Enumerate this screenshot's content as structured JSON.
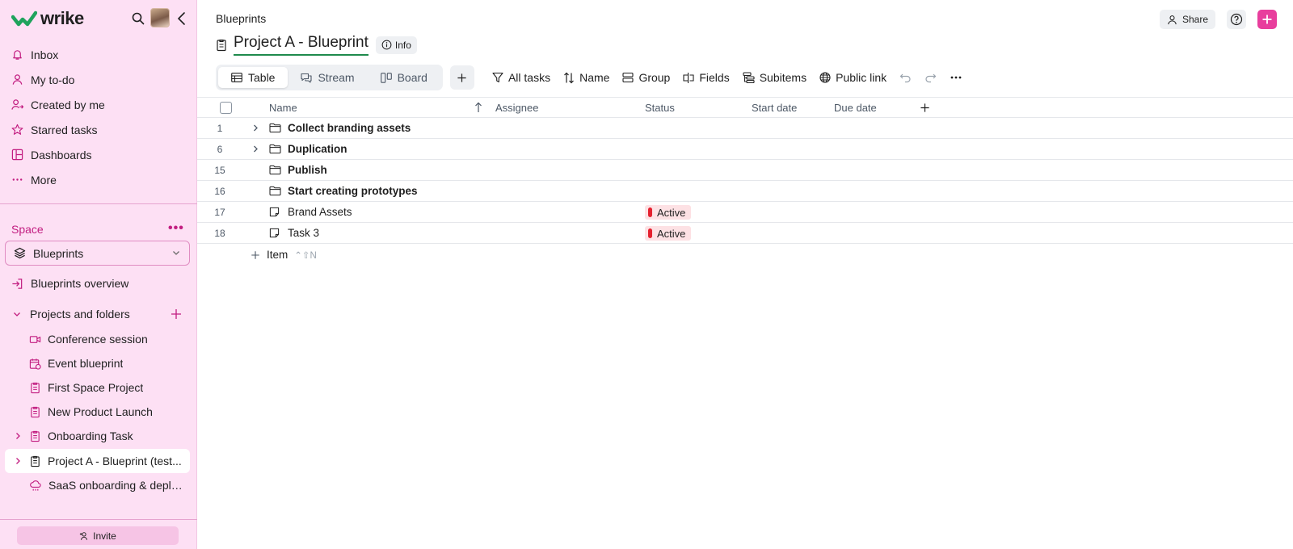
{
  "app": {
    "logo_text": "wrike",
    "brand_color": "#e83e9d",
    "sidebar_bg": "#fde0f4"
  },
  "sidebar": {
    "nav": [
      {
        "label": "Inbox",
        "icon": "bell-icon"
      },
      {
        "label": "My to-do",
        "icon": "person-icon"
      },
      {
        "label": "Created by me",
        "icon": "person-add-icon"
      },
      {
        "label": "Starred tasks",
        "icon": "star-icon"
      },
      {
        "label": "Dashboards",
        "icon": "dashboard-icon"
      },
      {
        "label": "More",
        "icon": "more-dots-icon"
      }
    ],
    "space_label": "Space",
    "space_selected": "Blueprints",
    "overview_label": "Blueprints overview",
    "projects_label": "Projects and folders",
    "tree": [
      {
        "label": "Conference session",
        "icon": "video-icon",
        "expandable": false,
        "selected": false
      },
      {
        "label": "Event blueprint",
        "icon": "calendar-icon",
        "expandable": false,
        "selected": false
      },
      {
        "label": "First Space Project",
        "icon": "project-icon",
        "expandable": false,
        "selected": false
      },
      {
        "label": "New Product Launch",
        "icon": "project-icon",
        "expandable": false,
        "selected": false
      },
      {
        "label": "Onboarding Task",
        "icon": "project-icon",
        "expandable": true,
        "selected": false
      },
      {
        "label": "Project A - Blueprint (test...",
        "icon": "project-icon",
        "expandable": true,
        "selected": true
      },
      {
        "label": "SaaS onboarding & deplo...",
        "icon": "cloud-icon",
        "expandable": false,
        "selected": false
      }
    ],
    "invite_label": "Invite"
  },
  "header": {
    "breadcrumb": "Blueprints",
    "title": "Project A - Blueprint",
    "info_label": "Info",
    "share_label": "Share"
  },
  "toolbar": {
    "views": [
      {
        "label": "Table",
        "icon": "table-icon",
        "active": true
      },
      {
        "label": "Stream",
        "icon": "stream-icon",
        "active": false
      },
      {
        "label": "Board",
        "icon": "board-icon",
        "active": false
      }
    ],
    "tools": [
      {
        "label": "All tasks",
        "icon": "filter-icon"
      },
      {
        "label": "Name",
        "icon": "sort-icon"
      },
      {
        "label": "Group",
        "icon": "group-icon"
      },
      {
        "label": "Fields",
        "icon": "fields-icon"
      },
      {
        "label": "Subitems",
        "icon": "subitems-icon"
      },
      {
        "label": "Public link",
        "icon": "globe-icon"
      }
    ]
  },
  "table": {
    "columns": {
      "name": "Name",
      "assignee": "Assignee",
      "status": "Status",
      "start": "Start date",
      "due": "Due date"
    },
    "rows": [
      {
        "num": "1",
        "name": "Collect branding assets",
        "type": "folder",
        "bold": true,
        "expandable": true,
        "status": ""
      },
      {
        "num": "6",
        "name": "Duplication",
        "type": "folder",
        "bold": true,
        "expandable": true,
        "status": ""
      },
      {
        "num": "15",
        "name": "Publish",
        "type": "folder",
        "bold": true,
        "expandable": false,
        "status": ""
      },
      {
        "num": "16",
        "name": "Start creating prototypes",
        "type": "folder",
        "bold": true,
        "expandable": false,
        "status": ""
      },
      {
        "num": "17",
        "name": "Brand Assets",
        "type": "task",
        "bold": false,
        "expandable": false,
        "status": "Active"
      },
      {
        "num": "18",
        "name": "Task 3",
        "type": "task",
        "bold": false,
        "expandable": false,
        "status": "Active"
      }
    ],
    "add_item_label": "Item",
    "add_item_shortcut": "⌃⇧N"
  }
}
